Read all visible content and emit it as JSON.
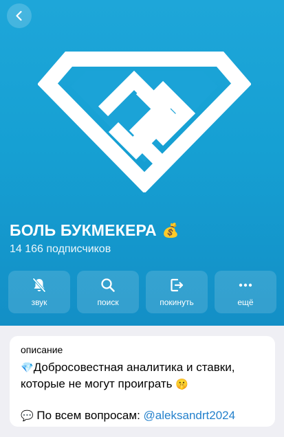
{
  "header": {
    "back_icon": "chevron-left-icon",
    "channel_title": "БОЛЬ БУКМЕКЕРА",
    "title_emoji": "💰",
    "subscribers": "14 166 подписчиков",
    "accent_color": "#16a0d3"
  },
  "actions": [
    {
      "label": "звук",
      "icon": "bell-slash-icon"
    },
    {
      "label": "поиск",
      "icon": "search-icon"
    },
    {
      "label": "покинуть",
      "icon": "leave-icon"
    },
    {
      "label": "ещё",
      "icon": "more-icon"
    }
  ],
  "description": {
    "label": "описание",
    "gem_emoji": "💎",
    "line1": "Добросовестная аналитика и ставки, которые не могут проиграть",
    "shush_emoji": "🤫",
    "speech_emoji": "💬",
    "line2_text": "По всем вопросам:",
    "line2_link": "@aleksandrt2024",
    "link_color": "#2481cc"
  }
}
